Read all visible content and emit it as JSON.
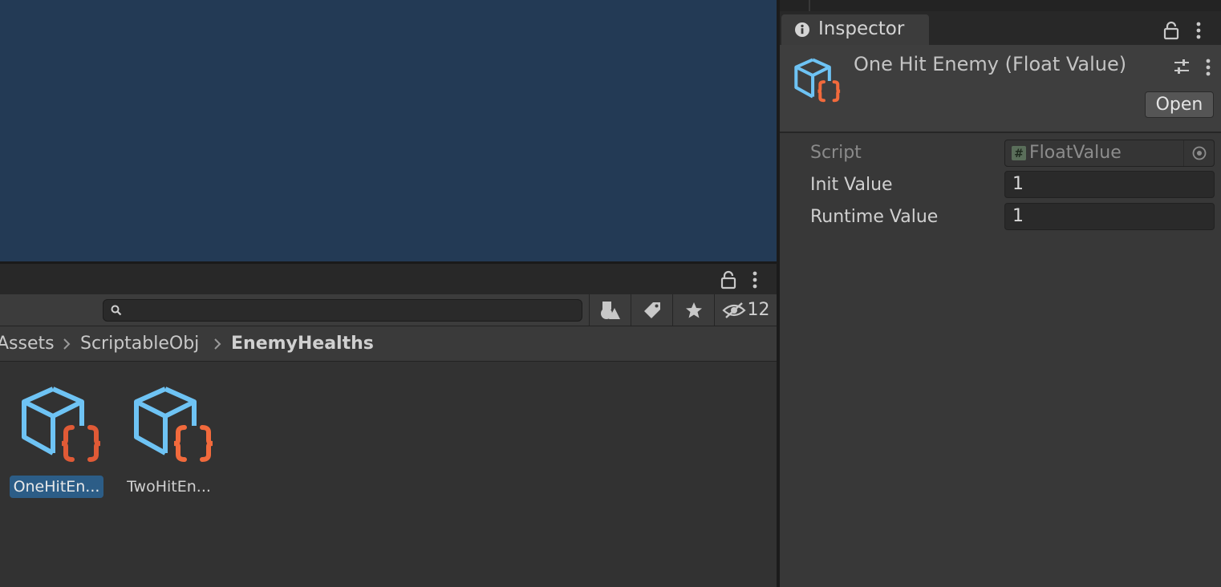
{
  "project": {
    "search": {
      "placeholder": "",
      "value": ""
    },
    "hidden_count": "12",
    "breadcrumb": [
      "Assets",
      "ScriptableObj",
      "EnemyHealths"
    ],
    "assets": [
      {
        "label": "OneHitEn...",
        "selected": true,
        "icon": "scriptable-object-icon"
      },
      {
        "label": "TwoHitEn...",
        "selected": false,
        "icon": "scriptable-object-icon"
      }
    ]
  },
  "inspector": {
    "tab_label": "Inspector",
    "title": "One Hit Enemy (Float Value)",
    "open_button": "Open",
    "properties": [
      {
        "label": "Script",
        "value": "FloatValue",
        "disabled": true
      },
      {
        "label": "Init Value",
        "value": "1",
        "disabled": false
      },
      {
        "label": "Runtime Value",
        "value": "1",
        "disabled": false
      }
    ]
  },
  "colors": {
    "scene_bg": "#233a55",
    "selection": "#2c5d87",
    "cube_icon": "#6ec3f4",
    "braces_icon": "#f26a3c"
  }
}
